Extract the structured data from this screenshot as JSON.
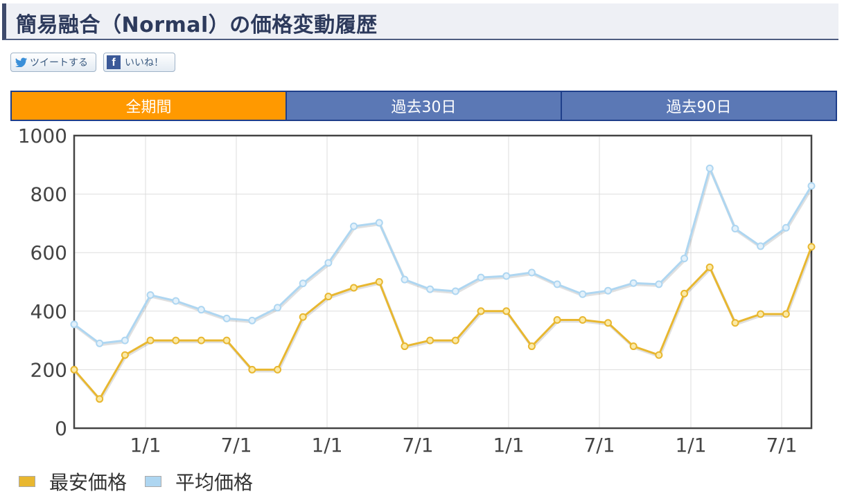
{
  "title": "簡易融合（Normal）の価格変動履歴",
  "share": {
    "tweet_label": "ツイートする",
    "like_label": "いいね！"
  },
  "tabs": [
    {
      "label": "全期間",
      "active": true
    },
    {
      "label": "過去30日",
      "active": false
    },
    {
      "label": "過去90日",
      "active": false
    }
  ],
  "colors": {
    "min_price": "#e8b730",
    "avg_price": "#aed6f1",
    "active_tab": "#ff9900",
    "tab": "#5b78b5"
  },
  "chart_data": {
    "type": "line",
    "ylim": [
      0,
      1000
    ],
    "y_ticks": [
      0,
      200,
      400,
      600,
      800,
      1000
    ],
    "x_tick_labels": [
      "1/1",
      "7/1",
      "1/1",
      "7/1",
      "1/1",
      "7/1",
      "1/1",
      "7/1"
    ],
    "grid": true,
    "legend_position": "bottom-left",
    "series": [
      {
        "name": "最安価格",
        "values": [
          200,
          100,
          250,
          300,
          300,
          300,
          300,
          200,
          200,
          380,
          450,
          480,
          500,
          280,
          300,
          300,
          400,
          400,
          280,
          370,
          370,
          360,
          280,
          250,
          460,
          550,
          360,
          390,
          390,
          620
        ]
      },
      {
        "name": "平均価格",
        "values": [
          355,
          290,
          300,
          455,
          435,
          405,
          375,
          368,
          412,
          495,
          565,
          690,
          702,
          508,
          475,
          468,
          515,
          520,
          532,
          492,
          458,
          470,
          496,
          492,
          580,
          888,
          682,
          622,
          685,
          828
        ]
      }
    ]
  }
}
